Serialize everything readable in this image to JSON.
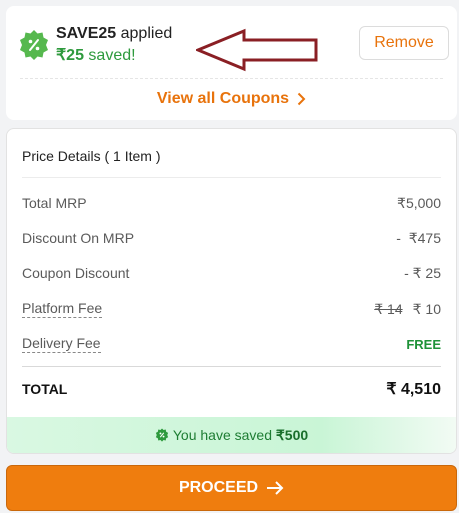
{
  "coupon": {
    "code": "SAVE25",
    "applied_text": " applied",
    "saved_amount": "₹25",
    "saved_suffix": " saved!",
    "remove_label": "Remove",
    "view_all_label": "View all Coupons",
    "badge_icon": "percent-badge-icon"
  },
  "price_details": {
    "title": "Price Details ( 1 Item )",
    "rows": [
      {
        "label": "Total MRP",
        "value": "₹5,000"
      },
      {
        "label": "Discount On MRP",
        "value": "-  ₹475"
      },
      {
        "label": "Coupon Discount",
        "value": "- ₹ 25"
      }
    ],
    "platform_fee": {
      "label": "Platform Fee",
      "original": "₹ 14",
      "value": "₹ 10"
    },
    "delivery_fee": {
      "label": "Delivery Fee",
      "value": "FREE"
    },
    "total": {
      "label": "TOTAL",
      "value": "₹ 4,510"
    },
    "saved_prefix": "You have saved ",
    "saved_amount": "₹500"
  },
  "proceed_label": "PROCEED",
  "colors": {
    "accent": "#ef7d0e",
    "green": "#2e9a3d",
    "saved_bar": "#d9f8e2"
  }
}
